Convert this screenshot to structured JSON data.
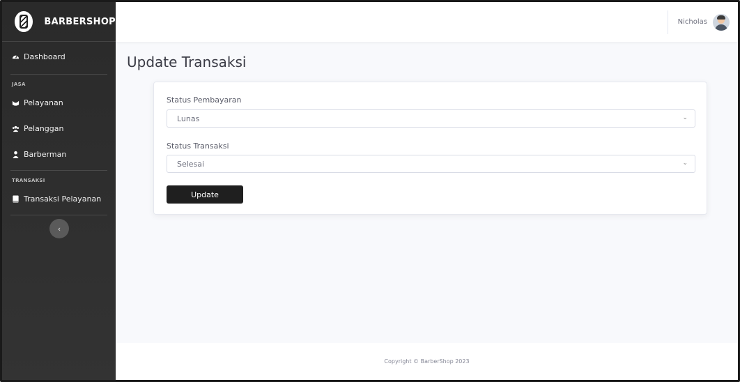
{
  "brand": {
    "name": "BARBERSHOP",
    "logo_icon": "barber-pole-icon"
  },
  "sidebar": {
    "dashboard": {
      "label": "Dashboard",
      "icon": "tachometer-icon"
    },
    "section_jasa": "JASA",
    "items_jasa": [
      {
        "label": "Pelayanan",
        "icon": "service-icon"
      },
      {
        "label": "Pelanggan",
        "icon": "users-icon"
      },
      {
        "label": "Barberman",
        "icon": "user-icon"
      }
    ],
    "section_transaksi": "TRANSAKSI",
    "items_transaksi": [
      {
        "label": "Transaksi Pelayanan",
        "icon": "book-icon"
      }
    ],
    "toggle_icon": "chevron-left-icon"
  },
  "topbar": {
    "user_name": "Nicholas",
    "avatar_icon": "avatar"
  },
  "page": {
    "title": "Update Transaksi"
  },
  "form": {
    "payment_status_label": "Status Pembayaran",
    "payment_status_value": "Lunas",
    "transaction_status_label": "Status Transaksi",
    "transaction_status_value": "Selesai",
    "submit_label": "Update"
  },
  "footer": {
    "text": "Copyright © BarberShop 2023"
  },
  "colors": {
    "sidebar": "#2f2f2f",
    "button": "#1f1f1f",
    "background": "#f8f9fc"
  }
}
